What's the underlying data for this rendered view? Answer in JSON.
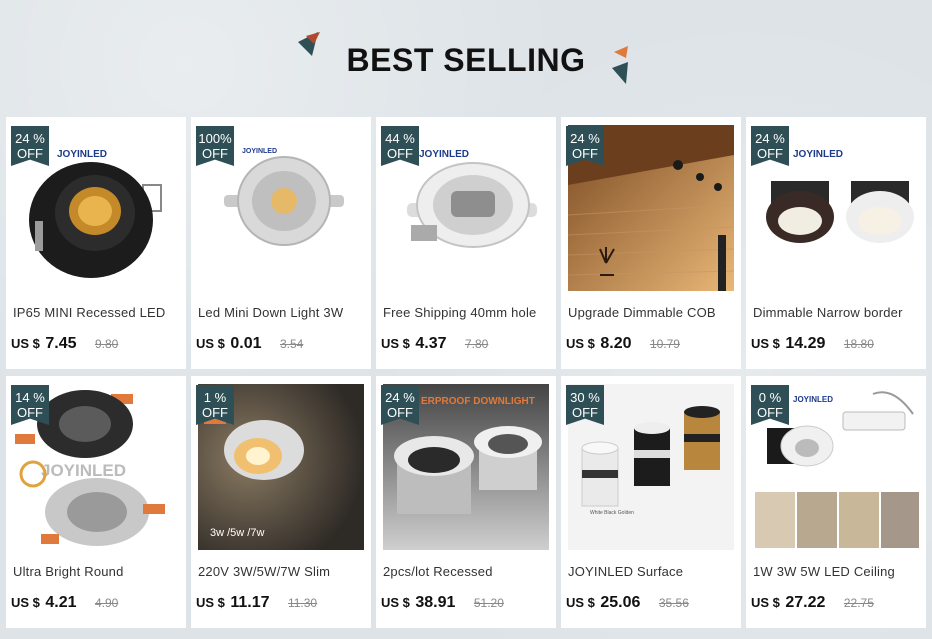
{
  "page": {
    "title": "BEST SELLING"
  },
  "colors": {
    "badge": "#2f4f56",
    "accent_orange": "#e07a3c"
  },
  "products": [
    {
      "badge": [
        "24 %",
        "OFF"
      ],
      "name": "IP65 MINI Recessed LED",
      "currency": "US $",
      "price": "7.45",
      "old_price": "9.80",
      "brand_text": "JOYINLED",
      "image": "black-round-downlight"
    },
    {
      "badge": [
        "100%",
        "OFF"
      ],
      "name": "Led Mini Down Light 3W",
      "currency": "US $",
      "price": "0.01",
      "old_price": "3.54",
      "brand_text": "JOYINLED",
      "image": "silver-mini-downlight"
    },
    {
      "badge": [
        "44 %",
        "OFF"
      ],
      "name": "Free Shipping 40mm hole",
      "currency": "US $",
      "price": "4.37",
      "old_price": "7.80",
      "brand_text": "JOYINLED",
      "image": "white-tilt-downlight"
    },
    {
      "badge": [
        "24 %",
        "OFF"
      ],
      "name": "Upgrade Dimmable COB",
      "currency": "US $",
      "price": "8.20",
      "old_price": "10.79",
      "brand_text": "",
      "image": "stone-wall-room"
    },
    {
      "badge": [
        "24 %",
        "OFF"
      ],
      "name": "Dimmable Narrow border",
      "currency": "US $",
      "price": "14.29",
      "old_price": "18.80",
      "brand_text": "JOYINLED",
      "image": "deep-anti-glare-spots"
    },
    {
      "badge": [
        "14 %",
        "OFF"
      ],
      "name": "Ultra Bright Round",
      "currency": "US $",
      "price": "4.21",
      "old_price": "4.90",
      "brand_text": "JOYINLED",
      "image": "round-spots-orange-clips"
    },
    {
      "badge": [
        "1 %",
        "OFF"
      ],
      "name": "220V 3W/5W/7W Slim",
      "currency": "US $",
      "price": "11.17",
      "old_price": "11.30",
      "brand_text": "3w /5w /7w",
      "image": "slim-spot-glow"
    },
    {
      "badge": [
        "24 %",
        "OFF"
      ],
      "name": "2pcs/lot Recessed",
      "currency": "US $",
      "price": "38.91",
      "old_price": "51.20",
      "brand_text": "ERPROOF DOWNLIGHT",
      "image": "waterproof-downlights"
    },
    {
      "badge": [
        "30 %",
        "OFF"
      ],
      "name": "JOYINLED Surface",
      "currency": "US $",
      "price": "25.06",
      "old_price": "35.56",
      "brand_text": "White  Black  Golden",
      "image": "surface-cylinders"
    },
    {
      "badge": [
        "0 %",
        "OFF"
      ],
      "name": "1W 3W 5W LED Ceiling",
      "currency": "US $",
      "price": "27.22",
      "old_price": "22.75",
      "brand_text": "JOYINLED",
      "image": "ceiling-spot-driver"
    }
  ]
}
